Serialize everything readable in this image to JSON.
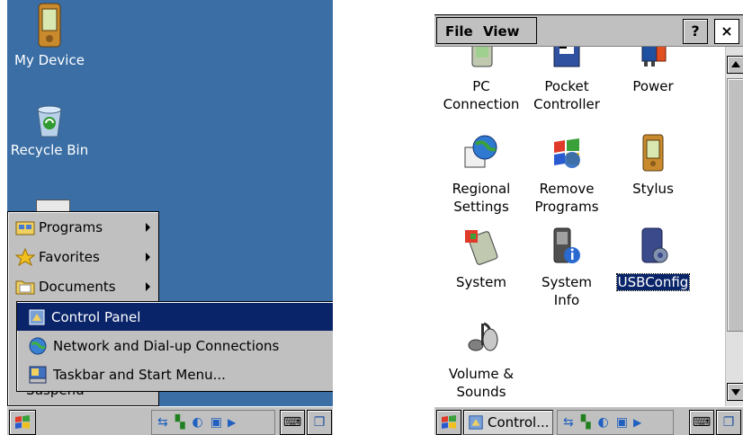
{
  "left": {
    "desktop_icons": [
      {
        "label": "My Device",
        "icon": "pda-device-icon"
      },
      {
        "label": "Recycle Bin",
        "icon": "recycle-bin-icon"
      }
    ],
    "start_menu": {
      "items": [
        {
          "label": "Programs",
          "icon": "programs-folder-icon",
          "has_submenu": true
        },
        {
          "label": "Favorites",
          "icon": "favorites-star-icon",
          "has_submenu": true
        },
        {
          "label": "Documents",
          "icon": "documents-folder-icon",
          "has_submenu": true
        }
      ],
      "partial_item": "Suspend"
    },
    "submenu": {
      "items": [
        {
          "label": "Control Panel",
          "icon": "control-panel-icon",
          "selected": true
        },
        {
          "label": "Network and Dial-up Connections",
          "icon": "network-globe-icon",
          "selected": false
        },
        {
          "label": "Taskbar and Start Menu...",
          "icon": "taskbar-settings-icon",
          "selected": false
        }
      ]
    },
    "taskbar": {
      "start_icon": "windows-flag-icon",
      "tray_icons": [
        "usb-connection-icon",
        "signal-icon",
        "network-icon",
        "battery-icon",
        "tray-arrow-icon"
      ],
      "keyboard_icon": "keyboard-icon",
      "desktop_icon": "show-desktop-icon"
    }
  },
  "right": {
    "menu": {
      "file_label": "File",
      "view_label": "View",
      "help_label": "?",
      "close_label": "×"
    },
    "items": [
      {
        "label_lines": [
          "PC",
          "Connection"
        ],
        "icon": "pc-connection-icon"
      },
      {
        "label_lines": [
          "Pocket",
          "Controller"
        ],
        "icon": "pocket-controller-icon"
      },
      {
        "label_lines": [
          "Power"
        ],
        "icon": "power-plug-icon"
      },
      {
        "label_lines": [
          "Regional",
          "Settings"
        ],
        "icon": "regional-settings-icon"
      },
      {
        "label_lines": [
          "Remove",
          "Programs"
        ],
        "icon": "remove-programs-icon"
      },
      {
        "label_lines": [
          "Stylus"
        ],
        "icon": "stylus-icon"
      },
      {
        "label_lines": [
          "System"
        ],
        "icon": "system-icon"
      },
      {
        "label_lines": [
          "System",
          "Info"
        ],
        "icon": "system-info-icon"
      },
      {
        "label_lines": [
          "USBConfig"
        ],
        "icon": "usb-config-icon",
        "selected": true
      },
      {
        "label_lines": [
          "Volume &",
          "Sounds"
        ],
        "icon": "volume-sounds-icon"
      }
    ],
    "taskbar": {
      "start_icon": "windows-flag-icon",
      "task_label": "Control...",
      "task_icon": "control-panel-icon"
    }
  },
  "colors": {
    "desktop": "#3a6ea5",
    "chrome": "#c0c0c0",
    "selection": "#0a246a"
  }
}
